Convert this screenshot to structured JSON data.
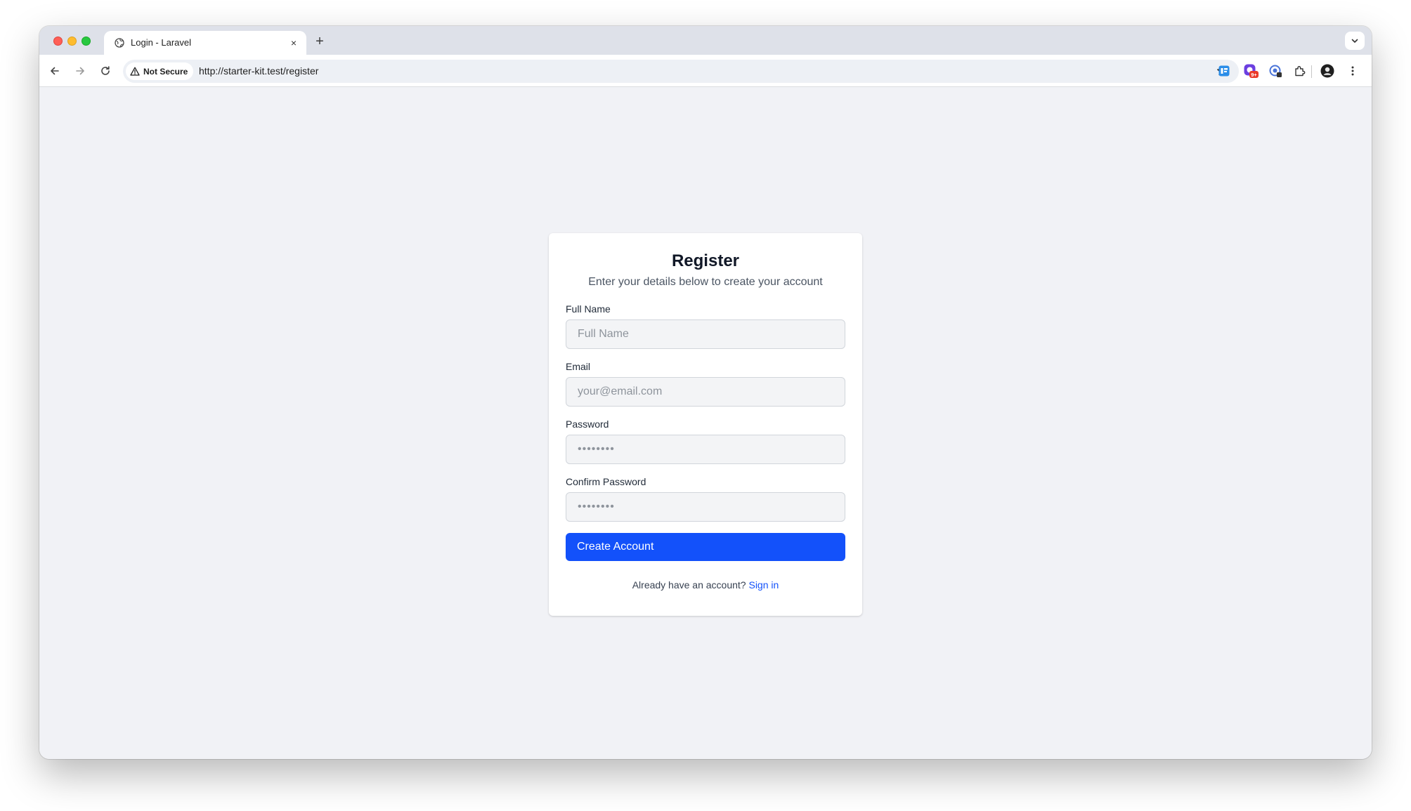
{
  "browser": {
    "tab": {
      "title": "Login - Laravel",
      "close_label": "×"
    },
    "new_tab_label": "+",
    "security_chip_label": "Not Secure",
    "url": "http://starter-kit.test/register",
    "extensions": [
      "form-extension-icon",
      "notification-extension-icon",
      "vpn-extension-icon",
      "puzzle-extensions-icon"
    ],
    "extension_badge": "9+"
  },
  "register_form": {
    "title": "Register",
    "subtitle": "Enter your details below to create your account",
    "fields": [
      {
        "label": "Full Name",
        "placeholder": "Full Name",
        "type": "text"
      },
      {
        "label": "Email",
        "placeholder": "your@email.com",
        "type": "email"
      },
      {
        "label": "Password",
        "placeholder": "••••••••",
        "type": "password"
      },
      {
        "label": "Confirm Password",
        "placeholder": "••••••••",
        "type": "password"
      }
    ],
    "submit_label": "Create Account",
    "footer_text": "Already have an account?",
    "footer_link": "Sign in"
  },
  "colors": {
    "primary_button": "#1351fa",
    "page_background": "#f1f2f6",
    "tabstrip": "#dee1e9"
  }
}
